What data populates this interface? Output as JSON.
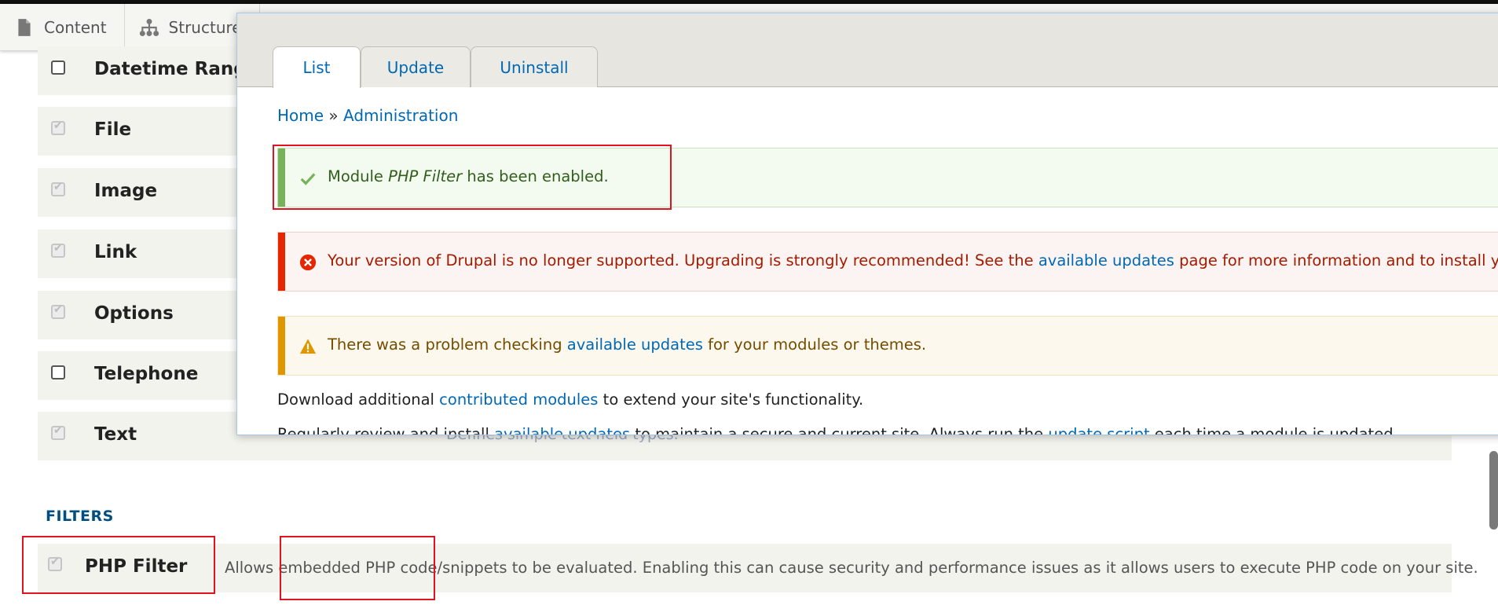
{
  "toolbar": {
    "items": [
      {
        "label": "Content",
        "icon": "document-icon"
      },
      {
        "label": "Structure",
        "icon": "sitemap-icon"
      }
    ]
  },
  "modules": {
    "rows": [
      {
        "name": "Datetime Range",
        "checked": false,
        "disabled": false
      },
      {
        "name": "File",
        "checked": true,
        "disabled": true
      },
      {
        "name": "Image",
        "checked": true,
        "disabled": true
      },
      {
        "name": "Link",
        "checked": true,
        "disabled": true
      },
      {
        "name": "Options",
        "checked": true,
        "disabled": true
      },
      {
        "name": "Telephone",
        "checked": false,
        "disabled": false
      },
      {
        "name": "Text",
        "checked": true,
        "disabled": true
      }
    ],
    "behind_text": "Defines simple text field types.",
    "filters_heading": "FILTERS",
    "php_filter": {
      "name": "PHP Filter",
      "description": "Allows embedded PHP code/snippets to be evaluated. Enabling this can cause security and performance issues as it allows users to execute PHP code on your site."
    }
  },
  "dialog": {
    "tabs": [
      "List",
      "Update",
      "Uninstall"
    ],
    "active_tab": "List",
    "breadcrumb": {
      "home": "Home",
      "separator": "»",
      "admin": "Administration"
    },
    "status": {
      "prefix": "Module ",
      "module": "PHP Filter",
      "suffix": " has been enabled."
    },
    "error": {
      "prefix": "Your version of Drupal is no longer supported. Upgrading is strongly recommended! See the ",
      "link": "available updates",
      "suffix": " page for more information and to install your missing updates."
    },
    "warning": {
      "prefix": "There was a problem checking ",
      "link": "available updates",
      "suffix": " for your modules or themes."
    },
    "download": {
      "prefix": "Download additional ",
      "link": "contributed modules",
      "suffix": " to extend your site's functionality."
    },
    "review": {
      "prefix": "Regularly review and install ",
      "link1": "available updates",
      "middle": " to maintain a secure and current site. Always run the ",
      "link2": "update script",
      "suffix": " each time a module is updated."
    }
  },
  "colors": {
    "link": "#0068b4",
    "status_bar": "#77b259",
    "error_bar": "#e62600",
    "warning_bar": "#e09600",
    "highlight_box": "#e0141e"
  }
}
